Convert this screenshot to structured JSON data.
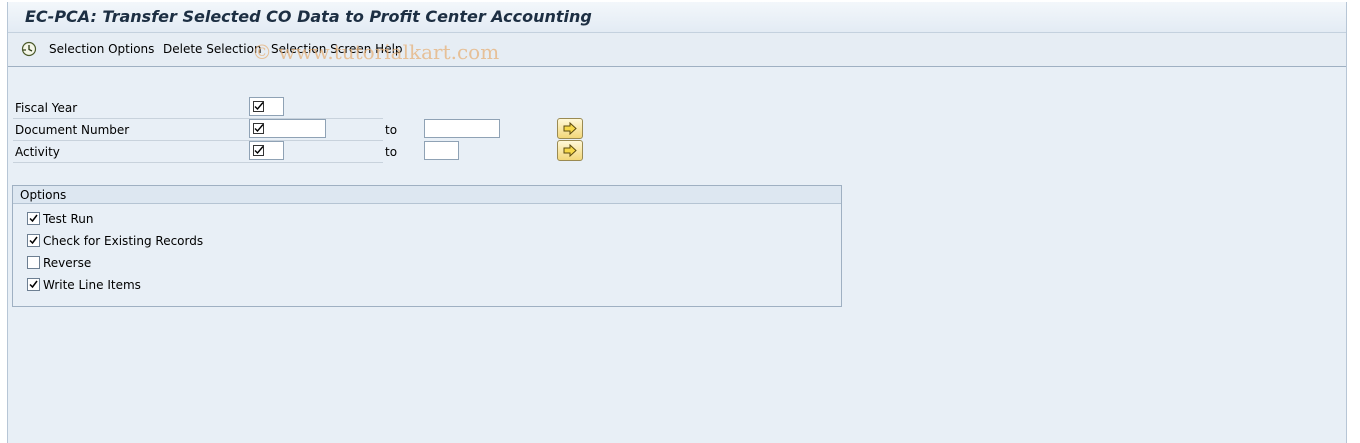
{
  "title": "EC-PCA: Transfer Selected CO Data to Profit Center Accounting",
  "toolbar": {
    "selection_options": "Selection Options",
    "delete_selection": "Delete Selection",
    "selection_screen_help": "Selection Screen Help"
  },
  "watermark": "© www.tutorialkart.com",
  "fields": {
    "fiscal_year": {
      "label": "Fiscal Year"
    },
    "document_number": {
      "label": "Document Number",
      "to_label": "to"
    },
    "activity": {
      "label": "Activity",
      "to_label": "to"
    }
  },
  "options": {
    "title": "Options",
    "items": [
      {
        "label": "Test Run",
        "checked": true
      },
      {
        "label": "Check for Existing Records",
        "checked": true
      },
      {
        "label": "Reverse",
        "checked": false
      },
      {
        "label": "Write Line Items",
        "checked": true
      }
    ]
  }
}
